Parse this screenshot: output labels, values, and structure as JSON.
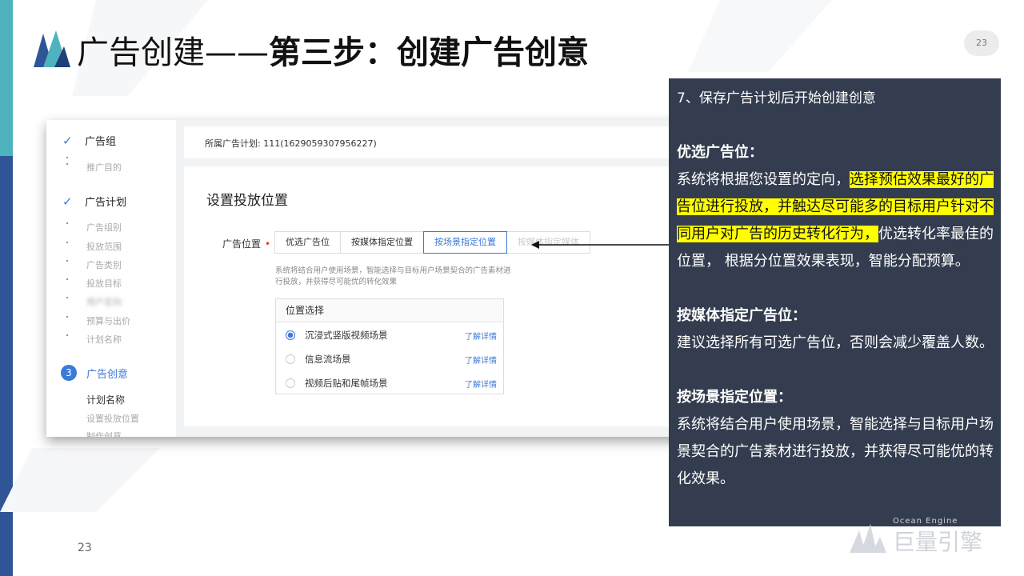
{
  "slide": {
    "title_normal": "广告创建——",
    "title_bold": "第三步：创建广告创意",
    "page_badge": "23",
    "footer_page": "23"
  },
  "screenshot": {
    "sidebar": {
      "steps": [
        {
          "label": "广告组",
          "state": "done"
        },
        {
          "label": "广告计划",
          "state": "done"
        },
        {
          "label": "广告创意",
          "state": "current",
          "number": "3"
        }
      ],
      "group_sub": [
        "推广目的"
      ],
      "plan_sub": [
        "广告组别",
        "投放范围",
        "广告类别",
        "投放目标",
        "用户定向",
        "预算与出价",
        "计划名称"
      ],
      "creative_sub": [
        "计划名称",
        "设置投放位置",
        "制作创意"
      ]
    },
    "topbar_label": "所属广告计划:  111(1629059307956227)",
    "section_title": "设置投放位置",
    "position_label": "广告位置",
    "position_required": "•",
    "tabs": [
      "优选广告位",
      "按媒体指定位置",
      "按场景指定位置",
      "按媒体指定媒体"
    ],
    "active_tab_index": 2,
    "description": "系统将结合用户使用场景，智能选择与目标用户场景契合的广告素材进行投放，并获得尽可能优的转化效果",
    "box_header": "位置选择",
    "options": [
      {
        "label": "沉浸式竖版视频场景",
        "link": "了解详情",
        "selected": true
      },
      {
        "label": "信息流场景",
        "link": "了解详情",
        "selected": false
      },
      {
        "label": "视频后贴和尾帧场景",
        "link": "了解详情",
        "selected": false
      }
    ]
  },
  "panel": {
    "intro": "7、保存广告计划后开始创建创意",
    "s1_title": "优选广告位：",
    "s1_pre": "系统将根据您设置的定向，",
    "s1_highlight": "选择预估效果最好的广告位进行投放，并触达尽可能多的目标用户针对不同用户对广告的历史转化行为，",
    "s1_post": "优选转化率最佳的位置， 根据分位置效果表现，智能分配预算。",
    "s2_title": "按媒体指定广告位：",
    "s2_body": "建议选择所有可选广告位，否则会减少覆盖人数。",
    "s3_title": "按场景指定位置：",
    "s3_body": "系统将结合用户使用场景，智能选择与目标用户场景契合的广告素材进行投放，并获得尽可能优的转化效果。"
  },
  "brand": {
    "small_text": "Ocean Engine",
    "name": "巨量引擎"
  },
  "colors": {
    "accent_blue": "#3b7ad9",
    "panel_bg": "#333d4f",
    "highlight": "#ffff00",
    "teal_bar": "#4fb3bf",
    "blue_bar": "#2f5597"
  }
}
